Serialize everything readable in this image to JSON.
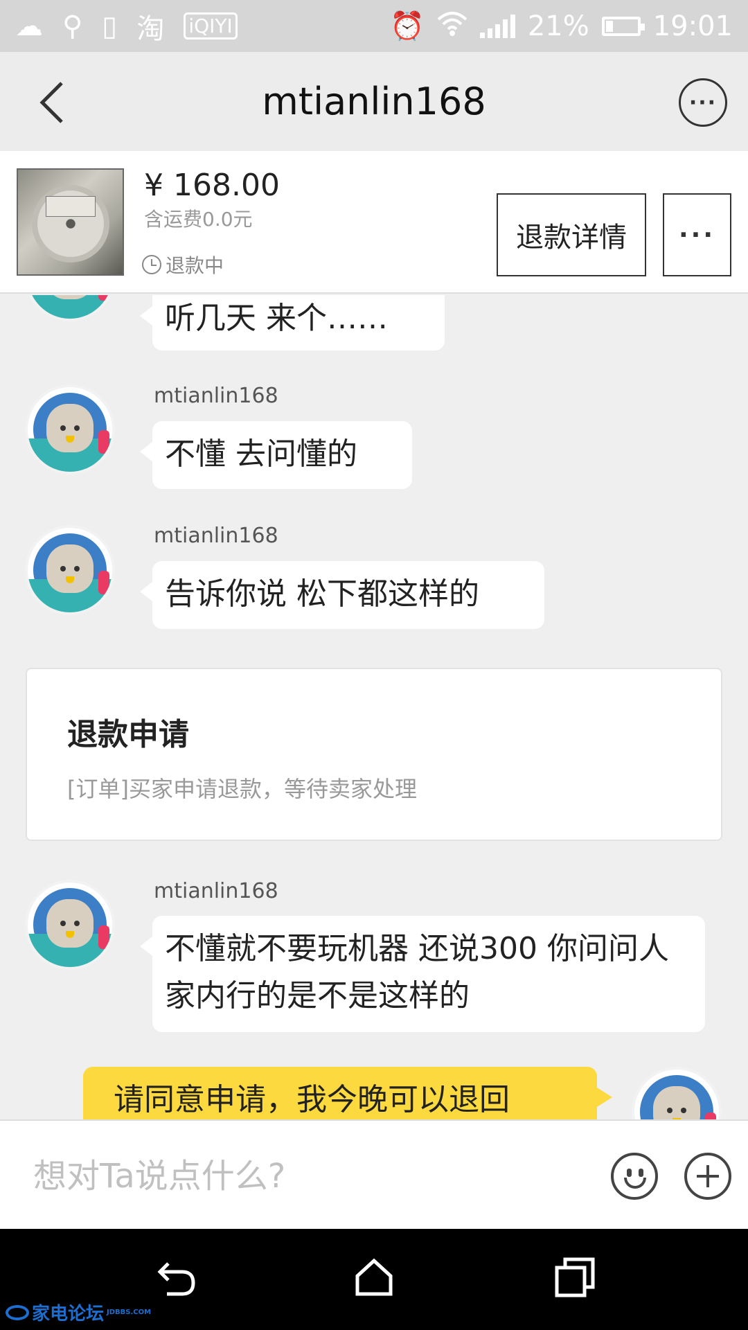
{
  "statusbar": {
    "battery_percent": "21%",
    "battery_level": 0.21,
    "time": "19:01",
    "icons": [
      "weather-icon",
      "search-icon",
      "device-icon",
      "taobao-icon",
      "iqiyi-icon",
      "alarm-icon",
      "wifi-icon",
      "signal-icon",
      "battery-icon"
    ],
    "taobao_glyph": "淘",
    "iqiyi_glyph": "iQIYI"
  },
  "header": {
    "title": "mtianlin168"
  },
  "order": {
    "price": "¥ 168.00",
    "shipping": "含运费0.0元",
    "status": "退款中",
    "refund_detail_label": "退款详情",
    "more_label": "···"
  },
  "messages": [
    {
      "sender": "",
      "text": "听几天 来个……"
    },
    {
      "sender": "mtianlin168",
      "text": "不懂 去问懂的"
    },
    {
      "sender": "mtianlin168",
      "text": "告诉你说 松下都这样的"
    },
    {
      "sender": "mtianlin168",
      "text": "不懂就不要玩机器 还说300 你问问人家内行的是不是这样的"
    },
    {
      "sender": "me",
      "text": "请同意申请，我今晚可以退回"
    }
  ],
  "notice": {
    "title": "退款申请",
    "desc": "[订单]买家申请退款，等待卖家处理"
  },
  "input": {
    "placeholder": "想对Ta说点什么?"
  },
  "watermark": {
    "text": "家电论坛",
    "sub": "JDBBS.COM"
  },
  "colors": {
    "my_bubble": "#fcd93f",
    "background": "#efefef",
    "statusbar": "#d6d6d6"
  }
}
